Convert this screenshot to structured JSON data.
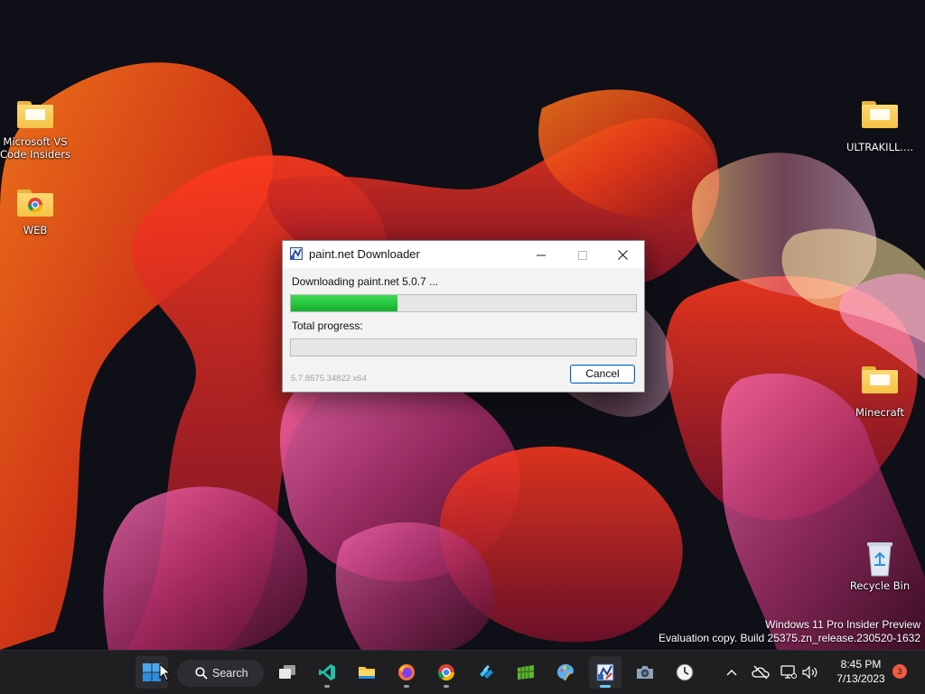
{
  "desktop": {
    "icons": [
      {
        "label": "Microsoft VS Code Insiders"
      },
      {
        "label": "WEB"
      },
      {
        "label": "ULTRAKILL...."
      },
      {
        "label": "Minecraft"
      },
      {
        "label": "Recycle Bin"
      }
    ]
  },
  "dialog": {
    "title": "paint.net Downloader",
    "status": "Downloading paint.net 5.0.7 ...",
    "download_progress": 0.31,
    "total_label": "Total progress:",
    "total_progress": 0.0,
    "version": "5.7.8575.34822 x64",
    "cancel_label": "Cancel",
    "minimize": "minimize-icon",
    "maximize": "maximize-icon",
    "close": "close-icon"
  },
  "watermark": {
    "line1": "Windows 11 Pro Insider Preview",
    "line2": "Evaluation copy. Build 25375.zn_release.230520-1632"
  },
  "taskbar": {
    "search_label": "Search",
    "apps": [
      "start-icon",
      "task-view-icon",
      "vscode-insiders-icon",
      "file-explorer-icon",
      "firefox-icon",
      "chrome-icon",
      "app-icon",
      "minecraft-icon",
      "paint-icon",
      "paint-net-icon",
      "camera-icon",
      "clock-icon"
    ],
    "tray": [
      "chevron-up-icon",
      "cloud-off-icon",
      "network-icon",
      "volume-icon"
    ],
    "time": "8:45 PM",
    "date": "7/13/2023",
    "notification_count": "3"
  },
  "colors": {
    "accent": "#0067c0",
    "progress": "#13b02c"
  }
}
